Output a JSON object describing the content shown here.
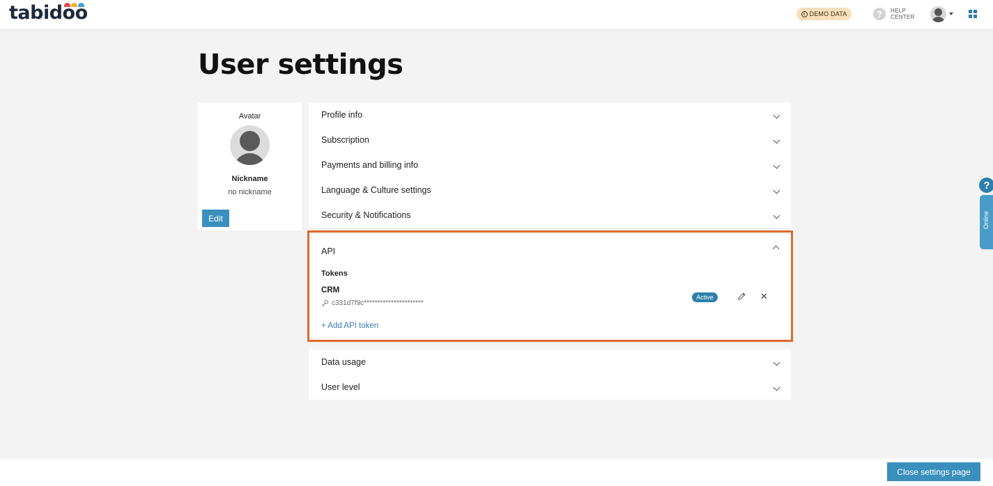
{
  "header": {
    "logo_text": "tabidoo",
    "demo_badge": "DEMO DATA",
    "help_line1": "HELP",
    "help_line2": "CENTER"
  },
  "page": {
    "title": "User settings"
  },
  "avatar_card": {
    "avatar_label": "Avatar",
    "nickname_label": "Nickname",
    "nickname_value": "no nickname",
    "edit_label": "Edit"
  },
  "sections": {
    "profile": "Profile info",
    "subscription": "Subscription",
    "payments": "Payments and billing info",
    "language": "Language & Culture settings",
    "security": "Security & Notifications",
    "api": "API",
    "data_usage": "Data usage",
    "user_level": "User level"
  },
  "api": {
    "tokens_label": "Tokens",
    "token_name": "CRM",
    "token_key": "c331d7f9c**********************",
    "token_status": "Active",
    "add_label": "+ Add API token"
  },
  "side_widget": {
    "help_glyph": "?",
    "online_label": "Online"
  },
  "footer": {
    "close_label": "Close settings page"
  },
  "colors": {
    "accent": "#3a8fbd",
    "highlight_border": "#e0692a",
    "demo_badge_bg": "#f7dfb9"
  }
}
